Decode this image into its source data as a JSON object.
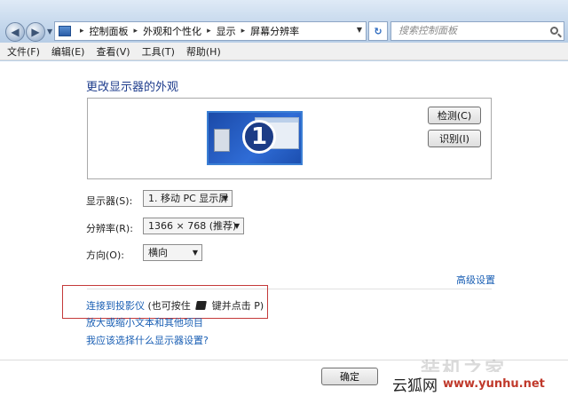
{
  "address": {
    "crumbs": [
      "控制面板",
      "外观和个性化",
      "显示",
      "屏幕分辨率"
    ],
    "search_placeholder": "搜索控制面板"
  },
  "menu": [
    "文件(F)",
    "编辑(E)",
    "查看(V)",
    "工具(T)",
    "帮助(H)"
  ],
  "main": {
    "heading": "更改显示器的外观",
    "monitor_number": "1",
    "detect_label": "检测(C)",
    "identify_label": "识别(I)",
    "display_label": "显示器(S):",
    "display_value": "1. 移动 PC 显示屏",
    "resolution_label": "分辨率(R):",
    "resolution_value": "1366 × 768 (推荐)",
    "orientation_label": "方向(O):",
    "orientation_value": "横向",
    "advanced_link": "高级设置",
    "projector_link": "连接到投影仪",
    "projector_hint_pre": "(也可按住",
    "projector_hint_post": "键并点击 P)",
    "zoom_link": "放大或缩小文本和其他项目",
    "why_link": "我应该选择什么显示器设置?",
    "ok_label": "确定"
  },
  "watermark": {
    "text": "装机之家",
    "brand_cn": "云狐网",
    "brand_url": "www.yunhu.net"
  }
}
